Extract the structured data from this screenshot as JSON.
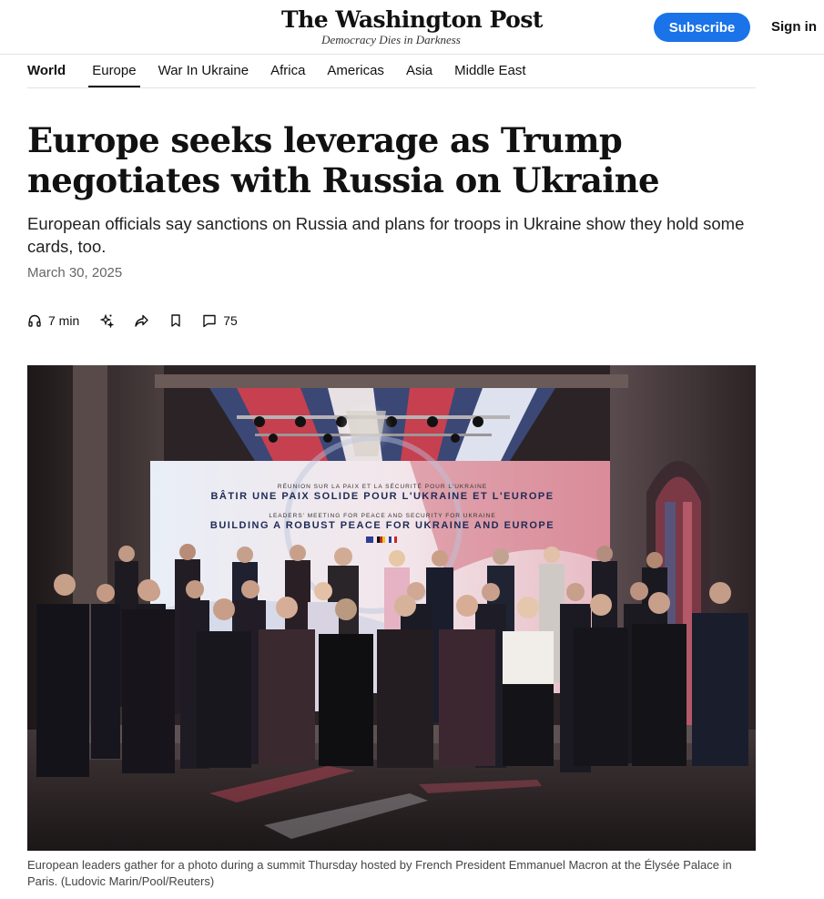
{
  "masthead": {
    "logo": "The Washington Post",
    "tagline": "Democracy Dies in Darkness",
    "subscribe_label": "Subscribe",
    "signin_label": "Sign in",
    "accent_color": "#1a73e8"
  },
  "section_nav": {
    "root": "World",
    "items": [
      {
        "label": "Europe",
        "active": true
      },
      {
        "label": "War In Ukraine"
      },
      {
        "label": "Africa"
      },
      {
        "label": "Americas"
      },
      {
        "label": "Asia"
      },
      {
        "label": "Middle East"
      }
    ]
  },
  "article": {
    "headline": "Europe seeks leverage as Trump negotiates with Russia on Ukraine",
    "dek": "European officials say sanctions on Russia and plans for troops in Ukraine show they hold some cards, too.",
    "date": "March 30, 2025",
    "tools": {
      "listen_label": "7 min",
      "listen_icon": "headphones-icon",
      "summary_icon": "sparkle-icon",
      "share_icon": "share-icon",
      "save_icon": "bookmark-icon",
      "comments_icon": "comment-icon",
      "comments_count": "75"
    },
    "photo": {
      "banner_line_1": "RÉUNION SUR LA PAIX ET LA SÉCURITÉ POUR L'UKRAINE",
      "banner_line_2": "BÂTIR UNE PAIX SOLIDE POUR L'UKRAINE ET L'EUROPE",
      "banner_line_3": "LEADERS' MEETING FOR PEACE AND SECURITY FOR UKRAINE",
      "banner_line_4": "BUILDING A ROBUST PEACE FOR UKRAINE AND EUROPE"
    },
    "caption": "European leaders gather for a photo during a summit Thursday hosted by French President Emmanuel Macron at the Élysée Palace in Paris. (Ludovic Marin/Pool/Reuters)"
  }
}
